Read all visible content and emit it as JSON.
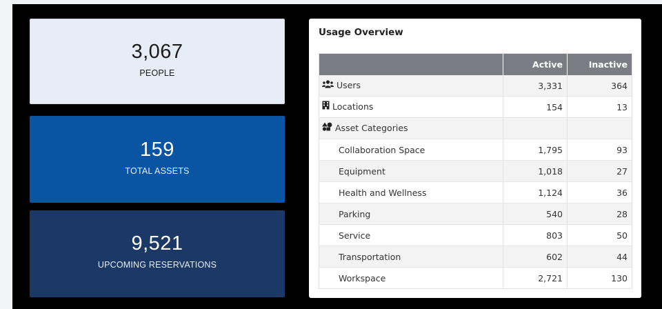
{
  "stats": {
    "people": {
      "value": "3,067",
      "label": "PEOPLE"
    },
    "assets": {
      "value": "159",
      "label": "TOTAL ASSETS"
    },
    "reservations": {
      "value": "9,521",
      "label": "UPCOMING RESERVATIONS"
    }
  },
  "usage": {
    "title": "Usage Overview",
    "columns": {
      "name": "",
      "active": "Active",
      "inactive": "Inactive"
    },
    "rows": [
      {
        "name": "Users",
        "icon": "users-icon",
        "active": "3,331",
        "inactive": "364"
      },
      {
        "name": "Locations",
        "icon": "building-icon",
        "active": "154",
        "inactive": "13"
      },
      {
        "name": "Asset Categories",
        "icon": "shapes-icon",
        "active": "",
        "inactive": ""
      },
      {
        "name": "Collaboration Space",
        "active": "1,795",
        "inactive": "93"
      },
      {
        "name": "Equipment",
        "active": "1,018",
        "inactive": "27"
      },
      {
        "name": "Health and Wellness",
        "active": "1,124",
        "inactive": "36"
      },
      {
        "name": "Parking",
        "active": "540",
        "inactive": "28"
      },
      {
        "name": "Service",
        "active": "803",
        "inactive": "50"
      },
      {
        "name": "Transportation",
        "active": "602",
        "inactive": "44"
      },
      {
        "name": "Workspace",
        "active": "2,721",
        "inactive": "130"
      }
    ]
  },
  "colors": {
    "people_card_bg": "#e6edf6",
    "assets_card_bg": "#0a55a3",
    "reservations_card_bg": "#1b3866",
    "table_header_bg": "#7a7e84"
  }
}
